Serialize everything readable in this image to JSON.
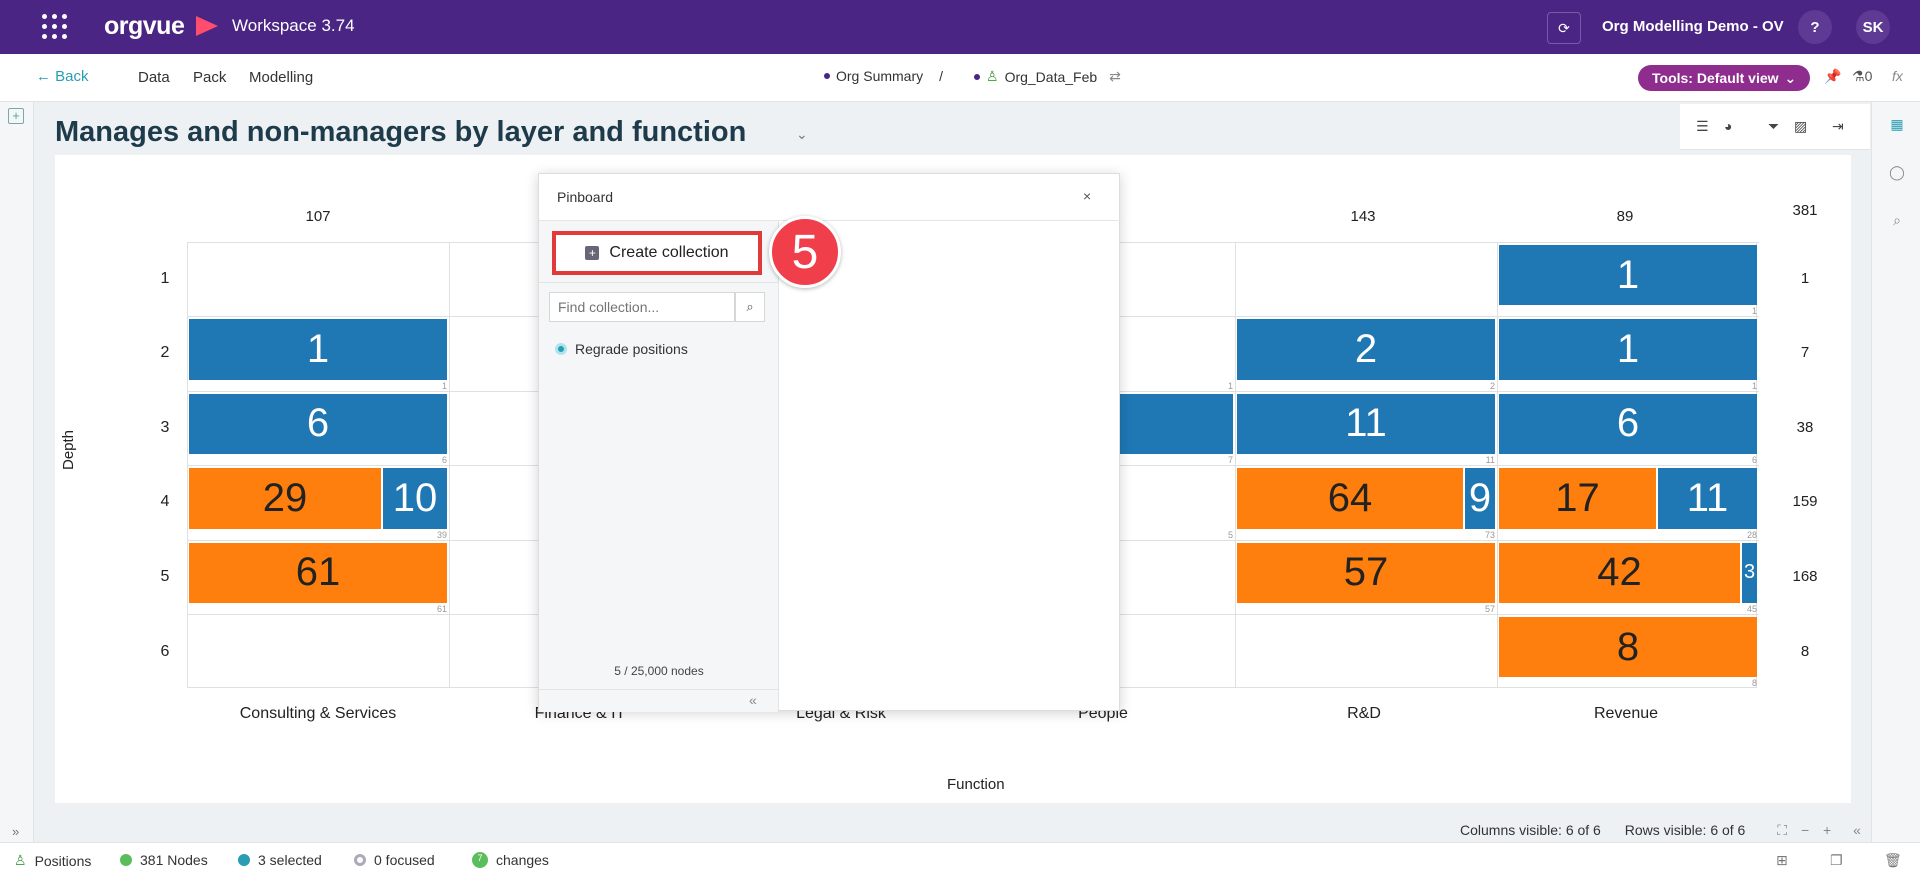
{
  "topbar": {
    "logo": "orgvue",
    "app_title": "Workspace  3.74",
    "project": "Org Modelling Demo - OV",
    "help": "?",
    "avatar": "SK",
    "refresh_icon": "refresh-icon",
    "apps_icon": "apps-grid-icon"
  },
  "nav": {
    "back": "← Back",
    "items": [
      "Data",
      "Pack",
      "Modelling"
    ],
    "crumb1": "Org Summary",
    "crumb_sep": "/",
    "crumb2": "Org_Data_Feb",
    "tools": "Tools: Default view",
    "flask_count": "0",
    "fx": "fx"
  },
  "view": {
    "title": "Manages and non-managers by layer and function",
    "y_label": "Depth",
    "x_label": "Function",
    "grand_total": "381",
    "columns_visible": "Columns visible: 6 of 6",
    "rows_visible": "Rows visible: 6 of 6"
  },
  "chart_data": {
    "type": "table",
    "functions": [
      "Consulting & Services",
      "Finance & IT",
      "Legal & Risk",
      "People",
      "R&D",
      "Revenue"
    ],
    "function_totals": [
      "107",
      "",
      "",
      "",
      "143",
      "89"
    ],
    "depths": [
      "1",
      "2",
      "3",
      "4",
      "5",
      "6"
    ],
    "depth_totals": [
      "1",
      "7",
      "38",
      "159",
      "168",
      "8"
    ],
    "visible_cells": [
      {
        "function": "Consulting & Services",
        "depth": "2",
        "managers": "1",
        "non_managers": "",
        "count": "1"
      },
      {
        "function": "Consulting & Services",
        "depth": "3",
        "managers": "6",
        "non_managers": "",
        "count": "6"
      },
      {
        "function": "Consulting & Services",
        "depth": "4",
        "managers": "10",
        "non_managers": "29",
        "count": "39"
      },
      {
        "function": "Consulting & Services",
        "depth": "5",
        "managers": "",
        "non_managers": "61",
        "count": "61"
      },
      {
        "function": "People",
        "depth": "2",
        "count": "1"
      },
      {
        "function": "People",
        "depth": "3",
        "managers": "2",
        "count": "7"
      },
      {
        "function": "People",
        "depth": "4",
        "count": "5"
      },
      {
        "function": "R&D",
        "depth": "2",
        "managers": "2",
        "non_managers": "",
        "count": "2"
      },
      {
        "function": "R&D",
        "depth": "3",
        "managers": "11",
        "non_managers": "",
        "count": "11"
      },
      {
        "function": "R&D",
        "depth": "4",
        "managers": "9",
        "non_managers": "64",
        "count": "73"
      },
      {
        "function": "R&D",
        "depth": "5",
        "managers": "",
        "non_managers": "57",
        "count": "57"
      },
      {
        "function": "Revenue",
        "depth": "1",
        "managers": "1",
        "non_managers": "",
        "count": "1"
      },
      {
        "function": "Revenue",
        "depth": "2",
        "managers": "1",
        "non_managers": "",
        "count": "1"
      },
      {
        "function": "Revenue",
        "depth": "3",
        "managers": "6",
        "non_managers": "",
        "count": "6"
      },
      {
        "function": "Revenue",
        "depth": "4",
        "managers": "11",
        "non_managers": "17",
        "count": "28"
      },
      {
        "function": "Revenue",
        "depth": "5",
        "managers": "3",
        "non_managers": "42",
        "count": "45"
      },
      {
        "function": "Revenue",
        "depth": "6",
        "managers": "",
        "non_managers": "8",
        "count": "8"
      }
    ],
    "colors": {
      "managers": "#1f77b4",
      "non_managers": "#ff7f0e"
    }
  },
  "pinboard": {
    "title": "Pinboard",
    "close": "×",
    "create": "Create collection",
    "step": "5",
    "find_placeholder": "Find collection...",
    "collection": "Regrade positions",
    "nodes": "5 / 25,000 nodes"
  },
  "bottom": {
    "positions": "Positions",
    "nodes": "381 Nodes",
    "selected": "3 selected",
    "focused": "0 focused",
    "changes": "changes",
    "changes_count": "7"
  }
}
